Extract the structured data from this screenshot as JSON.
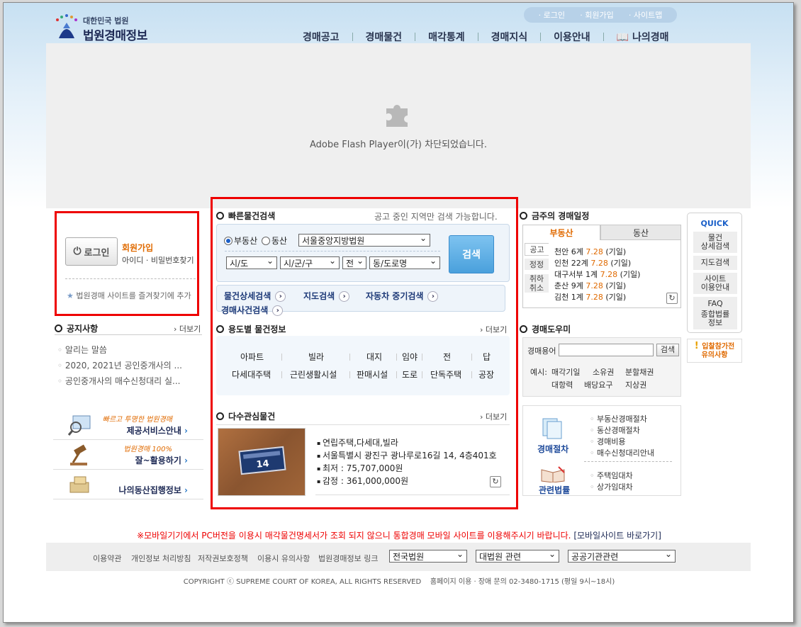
{
  "logo": {
    "sub": "대한민국 법원",
    "main": "법원경매정보"
  },
  "util_links": [
    "로그인",
    "회원가입",
    "사이트맵"
  ],
  "gnb": [
    "경매공고",
    "경매물건",
    "매각통계",
    "경매지식",
    "이용안내",
    "📖 나의경매"
  ],
  "flash_msg": "Adobe Flash Player이(가) 차단되었습니다.",
  "login": {
    "button": "로그인",
    "join": "회원가입",
    "find": "아이디 · 비밀번호찾기",
    "favorite": "법원경매 사이트를 즐겨찾기에 추가"
  },
  "notice": {
    "title": "공지사항",
    "more": "더보기",
    "items": [
      "알리는 말씀",
      "2020, 2021년 공인중개사의 ...",
      "공인중개사의 매수신청대리 실..."
    ]
  },
  "banners": [
    {
      "script": "빠르고 투명한 법원경매",
      "label": "제공서비스안내"
    },
    {
      "script": "법원경매 100%",
      "label": "잘~활용하기"
    },
    {
      "script": "",
      "label": "나의동산집행정보"
    }
  ],
  "quick_search": {
    "title": "빠른물건검색",
    "note": "공고 중인 지역만 검색 가능합니다.",
    "radio_realestate": "부동산",
    "radio_movable": "동산",
    "court": "서울중앙지방법원",
    "sido": "시/도",
    "sigungu": "시/군/구",
    "jeon": "전",
    "dong": "동/도로명",
    "search_btn": "검색",
    "links": [
      "물건상세검색",
      "지도검색",
      "자동차 중기검색",
      "경매사건검색"
    ]
  },
  "usage": {
    "title": "용도별 물건정보",
    "more": "더보기",
    "row1": [
      "아파트",
      "빌라",
      "대지",
      "임야",
      "전",
      "답"
    ],
    "row2": [
      "다세대주택",
      "근린생활시설",
      "판매시설",
      "도로",
      "단독주택",
      "공장"
    ]
  },
  "interest": {
    "title": "다수관심물건",
    "more": "더보기",
    "plate": "14",
    "items": [
      "연립주택,다세대,빌라",
      "서울특별시 광진구 광나루로16길 14, 4층401호",
      "최저 : 75,707,000원",
      "감정 : 361,000,000원"
    ]
  },
  "schedule": {
    "title": "금주의 경매일정",
    "tab_active": "부동산",
    "tab_other": "동산",
    "side_tabs": [
      "공고",
      "정정",
      "취하\n취소"
    ],
    "rows": [
      {
        "place": "천안 6계",
        "date": "7.28",
        "note": "(기일)"
      },
      {
        "place": "인천 22계",
        "date": "7.28",
        "note": "(기일)"
      },
      {
        "place": "대구서부 1계",
        "date": "7.28",
        "note": "(기일)"
      },
      {
        "place": "춘산 9계",
        "date": "7.28",
        "note": "(기일)"
      },
      {
        "place": "김천 1계",
        "date": "7.28",
        "note": "(기일)"
      }
    ]
  },
  "helper": {
    "title": "경매도우미",
    "label": "경매용어",
    "btn": "검색",
    "ex_label": "예시:",
    "ex_row1": [
      "매각기일",
      "소유권",
      "분할채권"
    ],
    "ex_row2": [
      "대항력",
      "배당요구",
      "지상권"
    ]
  },
  "procedure": {
    "label1": "경매절차",
    "items1": [
      "부동산경매절차",
      "동산경매절차",
      "경매비용",
      "매수신청대리안내"
    ],
    "label2": "관련법률",
    "items2": [
      "주택임대차",
      "상가임대차"
    ]
  },
  "quick_menu": {
    "title": "QUICK",
    "items": [
      "물건\n상세검색",
      "지도검색",
      "사이트\n이용안내",
      "FAQ",
      "종합법률\n정보"
    ]
  },
  "caution": {
    "line1": "입찰참가전",
    "line2": "유의사항"
  },
  "mobile_notice": {
    "text": "※모바일기기에서 PC버전을 이용시 매각물건명세서가 조회 되지 않으니 통합경매 모바일 사이트를 이용해주시기 바랍니다.",
    "link": "[모바일사이트 바로가기]"
  },
  "footer": {
    "links": [
      "이용약관",
      "개인정보 처리방침",
      "저작권보호정책",
      "이용시 유의사항",
      "법원경매정보 링크"
    ],
    "selects": [
      "전국법원",
      "대법원 관련",
      "공공기관관련"
    ],
    "copyright": "COPYRIGHT ⓒ SUPREME COURT OF KOREA, ALL RIGHTS RESERVED",
    "contact": "홈페이지 이용 · 장애 문의 02-3480-1715 (평일 9시~18시)"
  },
  "colors": {
    "accent": "#e06a00",
    "brand": "#1e2a55",
    "highlight_box": "#e00000"
  }
}
